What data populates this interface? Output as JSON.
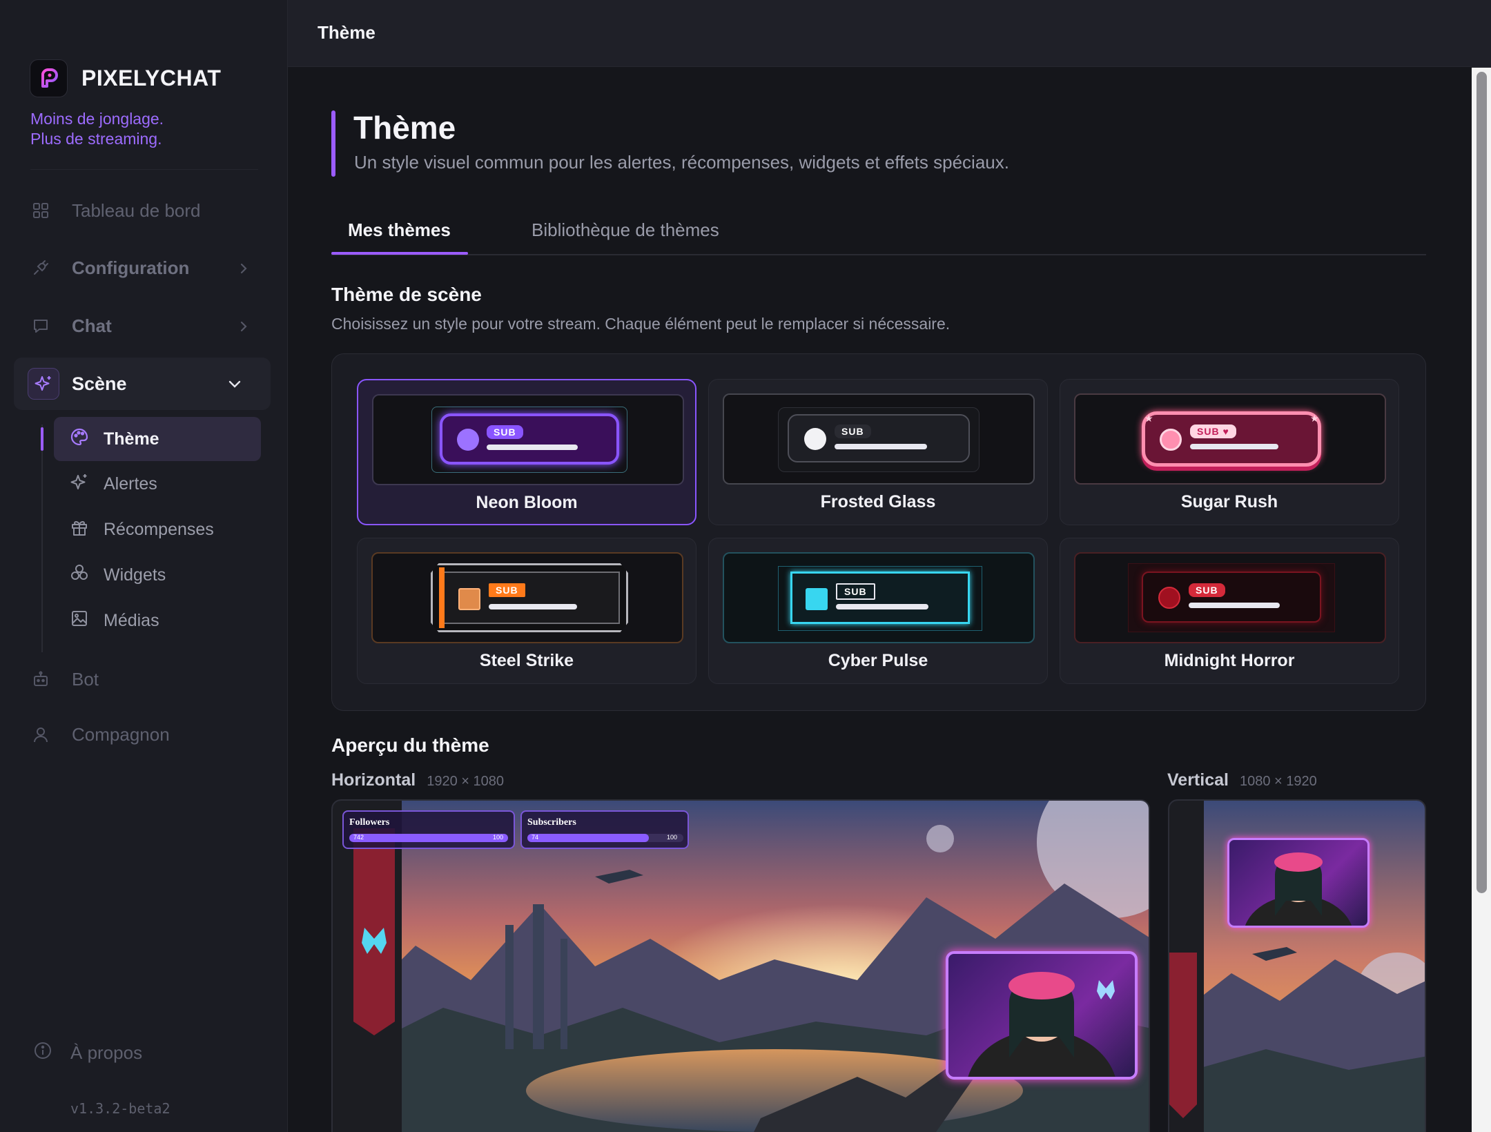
{
  "brand": {
    "name": "PIXELYCHAT",
    "tagline_1": "Moins de jonglage.",
    "tagline_2": "Plus de streaming."
  },
  "nav": {
    "dashboard": "Tableau de bord",
    "configuration": "Configuration",
    "chat": "Chat",
    "scene": "Scène",
    "scene_items": {
      "theme": "Thème",
      "alerts": "Alertes",
      "rewards": "Récompenses",
      "widgets": "Widgets",
      "media": "Médias"
    },
    "bot": "Bot",
    "companion": "Compagnon",
    "about": "À propos",
    "version": "v1.3.2-beta2"
  },
  "topbar": {
    "title": "Thème"
  },
  "page": {
    "title": "Thème",
    "subtitle": "Un style visuel commun pour les alertes, récompenses, widgets et effets spéciaux."
  },
  "tabs": {
    "mine": "Mes thèmes",
    "library": "Bibliothèque de thèmes"
  },
  "scene_theme": {
    "title": "Thème de scène",
    "subtitle": "Choisissez un style pour votre stream. Chaque élément peut le remplacer si nécessaire.",
    "badge": "SUB",
    "badge_heart": "SUB ♥",
    "themes": [
      {
        "name": "Neon Bloom",
        "selected": true,
        "accent": "#9b5cff"
      },
      {
        "name": "Frosted Glass",
        "selected": false,
        "accent": "#ffffff"
      },
      {
        "name": "Sugar Rush",
        "selected": false,
        "accent": "#ff5a8a"
      },
      {
        "name": "Steel Strike",
        "selected": false,
        "accent": "#ff7a1a"
      },
      {
        "name": "Cyber Pulse",
        "selected": false,
        "accent": "#38d6f0"
      },
      {
        "name": "Midnight Horror",
        "selected": false,
        "accent": "#d42a3a"
      }
    ]
  },
  "preview": {
    "title": "Aperçu du thème",
    "horizontal": {
      "label": "Horizontal",
      "dims": "1920 × 1080"
    },
    "vertical": {
      "label": "Vertical",
      "dims": "1080 × 1920"
    },
    "goals": [
      {
        "label": "Followers",
        "current": "742",
        "target": "100"
      },
      {
        "label": "Subscribers",
        "current": "74",
        "target": "100"
      }
    ]
  }
}
